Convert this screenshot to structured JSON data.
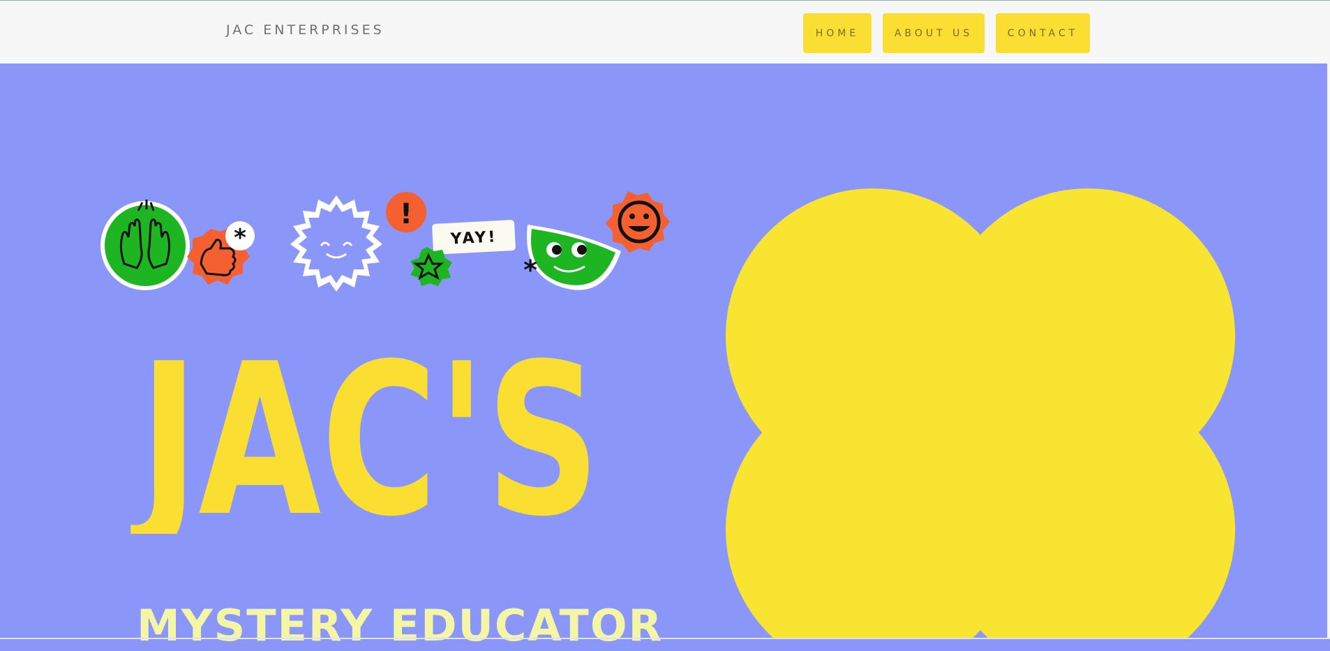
{
  "header": {
    "brand": "JAC ENTERPRISES",
    "nav": [
      {
        "label": "HOME"
      },
      {
        "label": "ABOUT US"
      },
      {
        "label": "CONTACT"
      }
    ]
  },
  "hero": {
    "stickers": {
      "yay_label": "YAY!",
      "exclaim": "!",
      "asterisk": "*"
    },
    "headline": "JAC'S",
    "subtitle": "MYSTERY EDUCATOR"
  },
  "colors": {
    "background": "#8a97f8",
    "accent_yellow": "#fbde32",
    "sticker_green": "#1db522",
    "sticker_orange": "#f4602f",
    "topbar": "#f7f7f7"
  }
}
